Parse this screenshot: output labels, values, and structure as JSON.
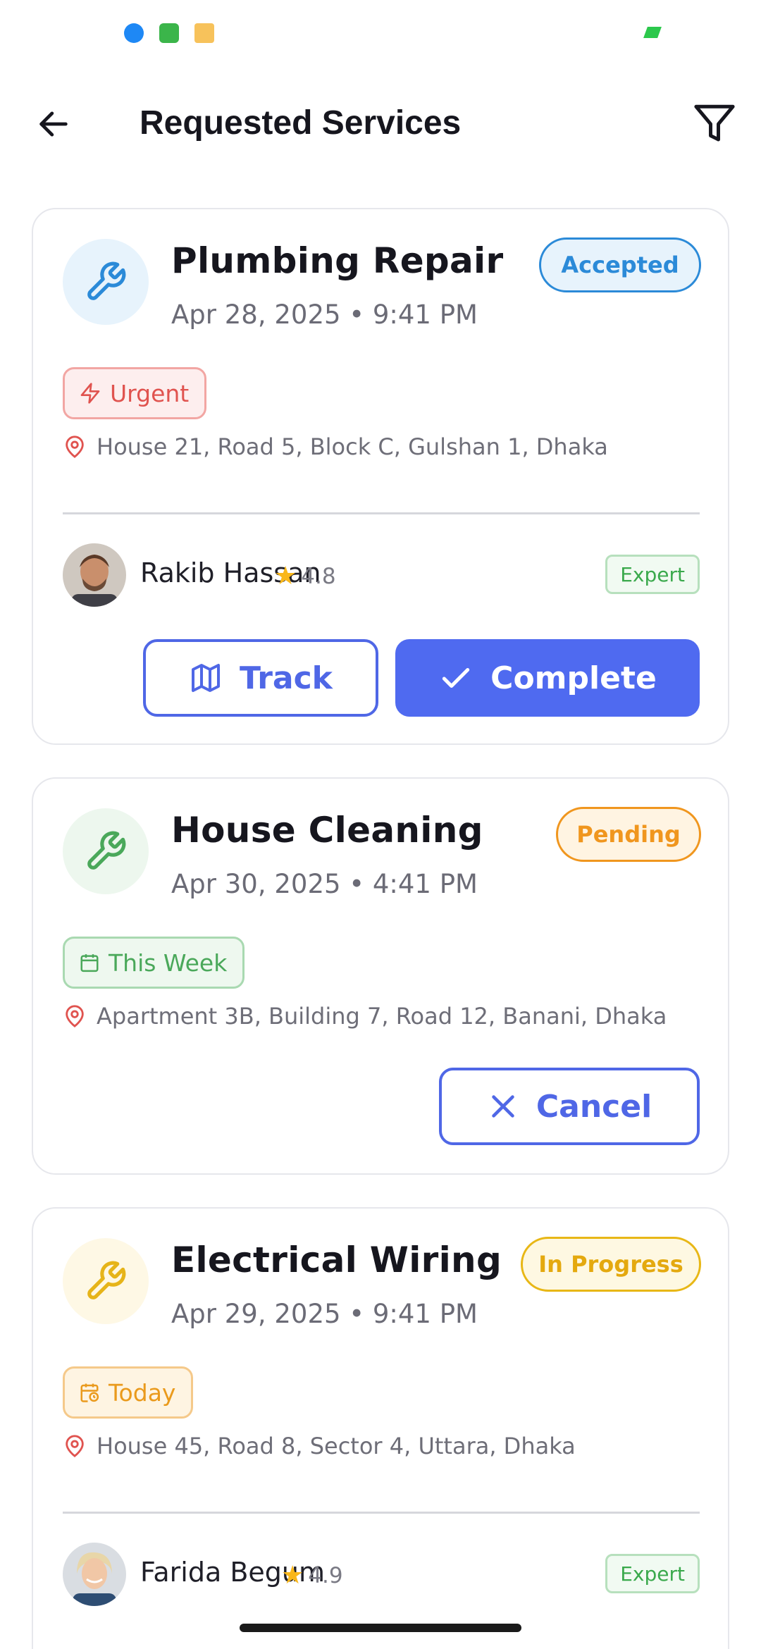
{
  "app_bar": {
    "title": "Requested Services"
  },
  "colors": {
    "primary": "#4f6af0",
    "accepted": "#2b8ad8",
    "pending": "#f0961e",
    "in_progress": "#e4a90f",
    "urgent": "#e0534f",
    "this_week": "#4aa85a",
    "today": "#ea9a1c"
  },
  "requests": [
    {
      "title": "Plumbing Repair",
      "datetime": "Apr 28, 2025 • 9:41 PM",
      "status": "Accepted",
      "tag": "Urgent",
      "tag_icon": "lightning-icon",
      "address": "House 21, Road 5, Block C, Gulshan 1, Dhaka",
      "provider": {
        "name": "Rakib Hassan",
        "rating": "4.8",
        "badge": "Expert"
      },
      "actions": {
        "track": "Track",
        "complete": "Complete"
      }
    },
    {
      "title": "House Cleaning",
      "datetime": "Apr 30, 2025 • 4:41 PM",
      "status": "Pending",
      "tag": "This Week",
      "tag_icon": "calendar-icon",
      "address": "Apartment 3B, Building 7, Road 12, Banani, Dhaka",
      "actions": {
        "cancel": "Cancel"
      }
    },
    {
      "title": "Electrical Wiring",
      "datetime": "Apr 29, 2025 • 9:41 PM",
      "status": "In Progress",
      "tag": "Today",
      "tag_icon": "calendar-clock-icon",
      "address": "House 45, Road 8, Sector 4, Uttara, Dhaka",
      "provider": {
        "name": "Farida Begum",
        "rating": "4.9",
        "badge": "Expert"
      }
    }
  ]
}
